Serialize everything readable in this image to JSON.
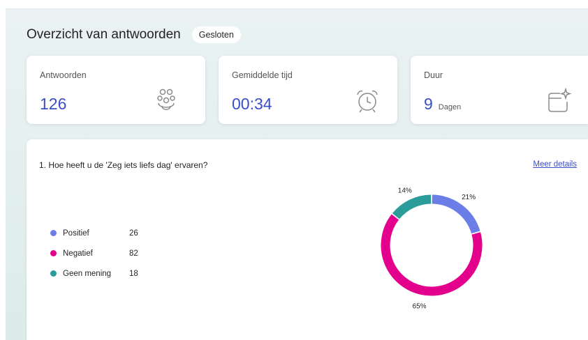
{
  "header": {
    "title": "Overzicht van antwoorden",
    "status": "Gesloten"
  },
  "stats": {
    "responses": {
      "label": "Antwoorden",
      "value": "126",
      "icon": "users-icon"
    },
    "avg_time": {
      "label": "Gemiddelde tijd",
      "value": "00:34",
      "icon": "alarm-clock-icon"
    },
    "duration": {
      "label": "Duur",
      "value": "9",
      "unit": "Dagen",
      "icon": "calendar-sparkle-icon"
    }
  },
  "question": {
    "text": "1. Hoe heeft u de 'Zeg iets liefs dag' ervaren?",
    "more_link": "Meer details"
  },
  "colors": {
    "accent": "#3b4ec8",
    "positief": "#6b7ee8",
    "negatief": "#e3008c",
    "geen": "#2a9d9a"
  },
  "chart_data": {
    "type": "pie",
    "categories": [
      "Positief",
      "Negatief",
      "Geen mening"
    ],
    "values": [
      26,
      82,
      18
    ],
    "percent_labels": [
      "21%",
      "65%",
      "14%"
    ],
    "colors": [
      "#6b7ee8",
      "#e3008c",
      "#2a9d9a"
    ],
    "donut": true,
    "legend_placement": "left"
  }
}
